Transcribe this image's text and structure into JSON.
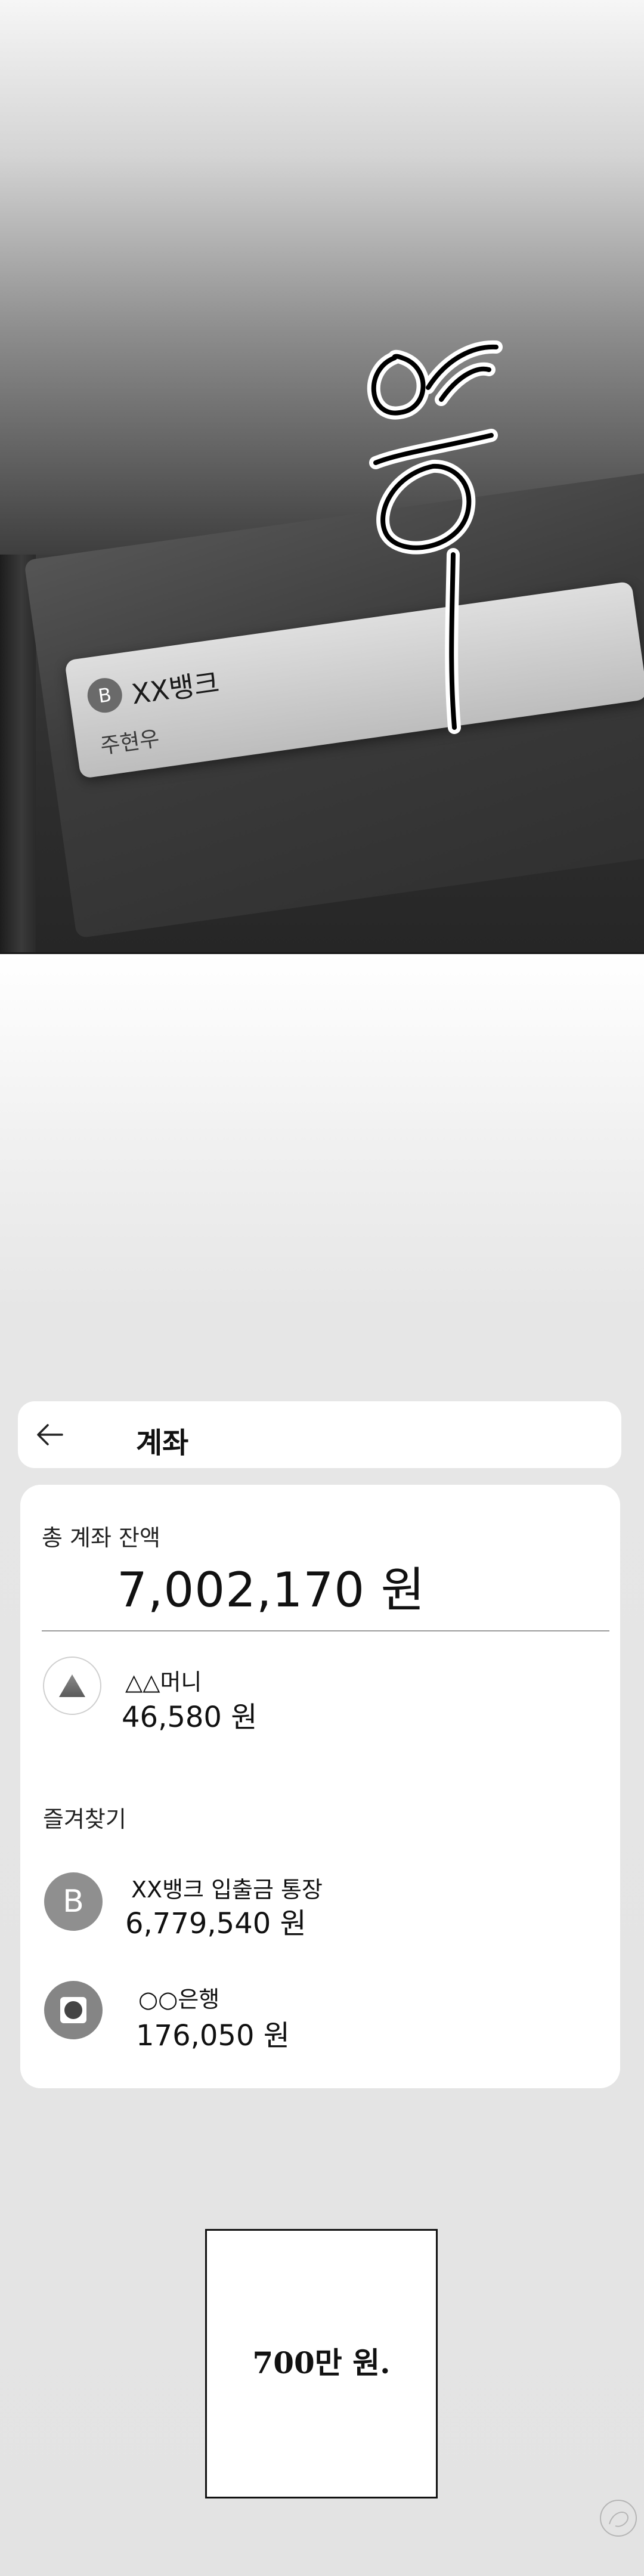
{
  "panel1": {
    "card": {
      "badge_letter": "B",
      "bank_name": "XX뱅크",
      "holder_name": "주현우"
    },
    "sound_effect": "웅ㅡ"
  },
  "app": {
    "header": {
      "title": "계좌",
      "back_icon": "arrow-left-icon"
    },
    "total": {
      "label": "총 계좌 잔액",
      "amount": "7,002,170 원"
    },
    "accounts": [
      {
        "icon": "triangle-icon",
        "name": "△△머니",
        "balance": "46,580 원"
      }
    ],
    "favorites_label": "즐겨찾기",
    "favorites": [
      {
        "icon": "b-letter-icon",
        "icon_letter": "B",
        "name": "XX뱅크 입출금 통장",
        "balance": "6,779,540 원"
      },
      {
        "icon": "square-circle-icon",
        "name": "○○은행",
        "balance": "176,050 원"
      }
    ]
  },
  "caption": "700만 원."
}
